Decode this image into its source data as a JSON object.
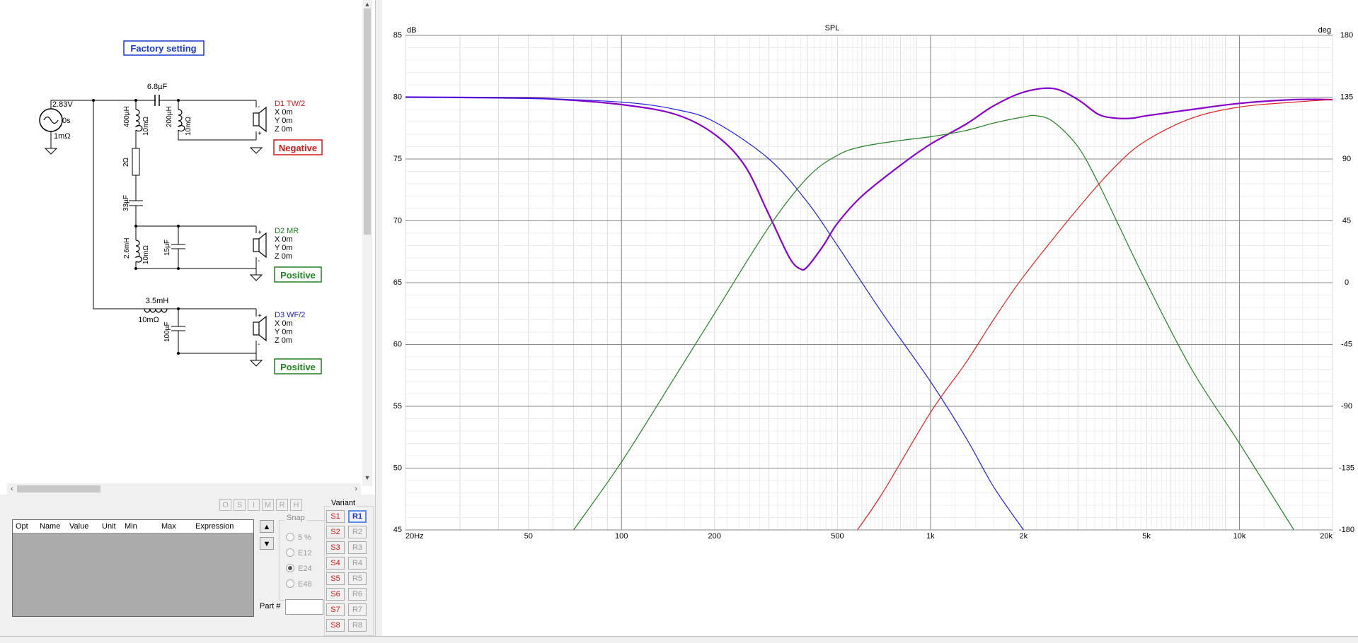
{
  "schematic": {
    "title": "Factory setting",
    "source": {
      "voltage": "2.83V",
      "delay": "0s",
      "resistance": "1mΩ"
    },
    "components": {
      "cap_series_tw": "6.8µF",
      "ind_shunt_1": "400µH",
      "ind_shunt_1_r": "10mΩ",
      "ind_shunt_2": "200µH",
      "ind_shunt_2_r": "10mΩ",
      "res": "2Ω",
      "cap_mr": "33µF",
      "ind_mr": "2.6mH",
      "ind_mr_r": "10mΩ",
      "cap_mr_shunt": "15µF",
      "ind_wf": "3.5mH",
      "ind_wf_r": "10mΩ",
      "cap_wf": "100µF"
    },
    "drivers": [
      {
        "name": "D1 TW/2",
        "x": "X 0m",
        "y": "Y 0m",
        "z": "Z 0m",
        "polarity": "Negative",
        "color": "#d01818",
        "plus_top": "-",
        "plus_bottom": "+"
      },
      {
        "name": "D2 MR",
        "x": "X 0m",
        "y": "Y 0m",
        "z": "Z 0m",
        "polarity": "Positive",
        "color": "#208020",
        "plus_top": "+",
        "plus_bottom": "-"
      },
      {
        "name": "D3 WF/2",
        "x": "X 0m",
        "y": "Y 0m",
        "z": "Z 0m",
        "polarity": "Positive",
        "color": "#2020d0",
        "plus_top": "+",
        "plus_bottom": "-"
      }
    ]
  },
  "toolbar_mini": [
    "O",
    "S",
    "I",
    "M",
    "R",
    "H"
  ],
  "optimizer_table": {
    "columns": [
      "Opt",
      "Name",
      "Value",
      "Unit",
      "Min",
      "Max",
      "Expression"
    ]
  },
  "move_up_icon": "▲",
  "move_down_icon": "▼",
  "snap": {
    "title": "Snap",
    "options": [
      "5 %",
      "E12",
      "E24",
      "E48"
    ],
    "selected": "E24"
  },
  "part": {
    "label": "Part #",
    "value": ""
  },
  "variant": {
    "title": "Variant",
    "s_buttons": [
      "S1",
      "S2",
      "S3",
      "S4",
      "S5",
      "S6",
      "S7",
      "S8"
    ],
    "r_buttons": [
      "R1",
      "R2",
      "R3",
      "R4",
      "R5",
      "R6",
      "R7",
      "R8"
    ],
    "selected_r": "R1"
  },
  "chart_data": {
    "type": "line",
    "title": "SPL",
    "ylabel": "dB",
    "y2label": "deg",
    "xscale": "log",
    "xlim": [
      20,
      20000
    ],
    "ylim": [
      45,
      85
    ],
    "y2lim": [
      -180,
      180
    ],
    "grid": true,
    "xticks": [
      {
        "v": 20,
        "label": "20Hz"
      },
      {
        "v": 50,
        "label": "50"
      },
      {
        "v": 100,
        "label": "100"
      },
      {
        "v": 200,
        "label": "200"
      },
      {
        "v": 500,
        "label": "500"
      },
      {
        "v": 1000,
        "label": "1k"
      },
      {
        "v": 2000,
        "label": "2k"
      },
      {
        "v": 5000,
        "label": "5k"
      },
      {
        "v": 10000,
        "label": "10k"
      },
      {
        "v": 20000,
        "label": "20k"
      }
    ],
    "yticks": [
      85,
      80,
      75,
      70,
      65,
      60,
      55,
      50,
      45
    ],
    "y2ticks": [
      180,
      135,
      90,
      45,
      0,
      -45,
      -90,
      -135,
      -180
    ],
    "series": [
      {
        "color": "#8800cc",
        "width": 2.2,
        "x": [
          20,
          40,
          60,
          100,
          150,
          200,
          250,
          300,
          350,
          380,
          400,
          450,
          500,
          600,
          800,
          1000,
          1300,
          1600,
          2000,
          2500,
          3000,
          3500,
          4000,
          4500,
          5000,
          7000,
          10000,
          15000,
          20000
        ],
        "y": [
          80,
          79.95,
          79.85,
          79.4,
          78.6,
          77.0,
          74.5,
          70.5,
          67.0,
          66.1,
          66.3,
          68.0,
          69.8,
          72.0,
          74.5,
          76.2,
          77.8,
          79.3,
          80.4,
          80.7,
          79.8,
          78.6,
          78.3,
          78.3,
          78.5,
          79.0,
          79.5,
          79.8,
          79.8
        ]
      },
      {
        "color": "#2020e0",
        "width": 1.2,
        "x": [
          20,
          50,
          100,
          150,
          200,
          300,
          400,
          500,
          700,
          1000,
          1300,
          1600,
          2000
        ],
        "y": [
          80,
          79.9,
          79.6,
          79.0,
          78.0,
          75.0,
          71.5,
          68.0,
          62.5,
          57.0,
          52.5,
          48.5,
          45
        ]
      },
      {
        "color": "#208020",
        "width": 1.2,
        "x": [
          70,
          100,
          150,
          200,
          300,
          400,
          500,
          600,
          800,
          1000,
          1300,
          1600,
          2000,
          2200,
          2500,
          3000,
          3500,
          4000,
          5000,
          7000,
          10000,
          15000
        ],
        "y": [
          45,
          50.5,
          57.5,
          62.5,
          69.5,
          73.5,
          75.3,
          76.0,
          76.5,
          76.8,
          77.3,
          77.9,
          78.4,
          78.5,
          78.0,
          76.0,
          73.0,
          70.0,
          65.0,
          58.0,
          52.0,
          45
        ]
      },
      {
        "color": "#e02020",
        "width": 1.2,
        "x": [
          580,
          700,
          1000,
          1300,
          1600,
          2000,
          3000,
          4000,
          5000,
          7000,
          10000,
          15000,
          20000
        ],
        "y": [
          45,
          48,
          54.5,
          58.5,
          62.0,
          65.5,
          71.0,
          74.5,
          76.5,
          78.3,
          79.2,
          79.6,
          79.8
        ]
      }
    ]
  }
}
